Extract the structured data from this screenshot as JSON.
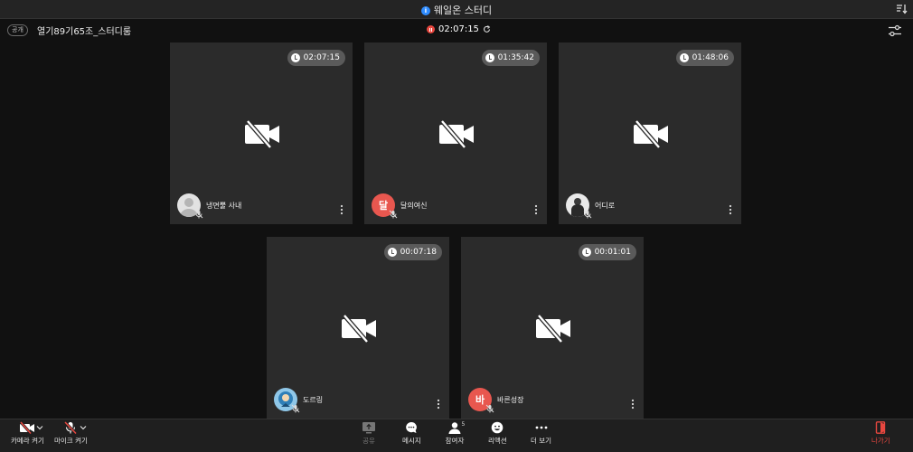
{
  "window": {
    "title": "웨일온 스터디"
  },
  "room": {
    "visibility_badge": "공개",
    "name": "열기89기65조_스터디룸",
    "elapsed": "02:07:15"
  },
  "participants": [
    {
      "name": "냉면뿔 사내",
      "time": "02:07:15",
      "avatar_type": "default",
      "avatar_text": ""
    },
    {
      "name": "달의여신",
      "time": "01:35:42",
      "avatar_type": "letter",
      "avatar_text": "달",
      "avatar_color": "#e8574f"
    },
    {
      "name": "어디로",
      "time": "01:48:06",
      "avatar_type": "photo-person",
      "avatar_text": ""
    },
    {
      "name": "도르링",
      "time": "00:07:18",
      "avatar_type": "photo-character",
      "avatar_text": ""
    },
    {
      "name": "바른성장",
      "time": "00:01:01",
      "avatar_type": "letter",
      "avatar_text": "바",
      "avatar_color": "#e8574f"
    }
  ],
  "toolbar": {
    "camera_label": "카메라 켜기",
    "mic_label": "마이크 켜기",
    "share_label": "공유",
    "message_label": "메시지",
    "participants_label": "참여자",
    "participants_count": "5",
    "reaction_label": "리액션",
    "more_label": "더 보기",
    "leave_label": "나가기"
  },
  "icons": {
    "camera": "camera-off-icon",
    "mic": "mic-off-icon",
    "share": "share-screen-icon",
    "message": "chat-bubble-icon",
    "participants": "person-icon",
    "reaction": "smiley-icon",
    "more": "ellipsis-icon",
    "leave": "exit-door-icon",
    "settings": "sliders-icon",
    "sort": "sort-icon",
    "timer": "clock-icon"
  },
  "colors": {
    "accent_red": "#e8473f",
    "info_blue": "#2f8cff",
    "tile_bg": "#2b2b2b"
  }
}
